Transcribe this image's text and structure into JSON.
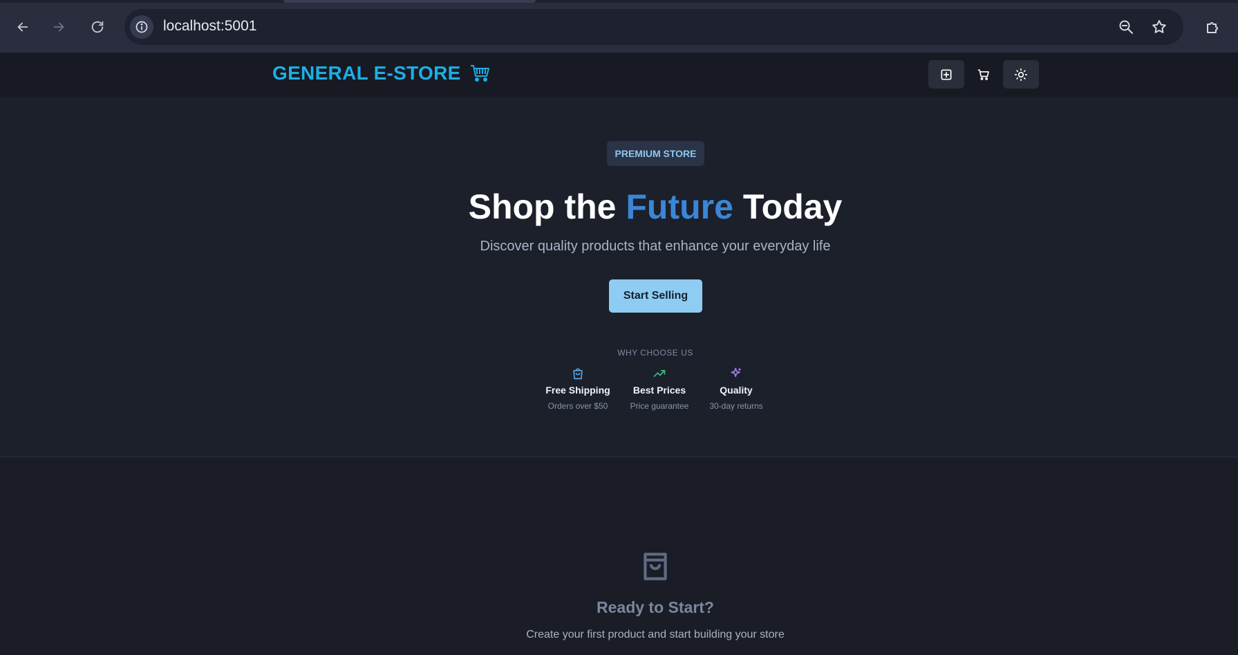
{
  "browser": {
    "url": "localhost:5001"
  },
  "header": {
    "logo_text": "GENERAL E-STORE"
  },
  "hero": {
    "badge": "PREMIUM STORE",
    "title_before": "Shop the ",
    "title_accent": "Future",
    "title_after": " Today",
    "subtitle": "Discover quality products that enhance your everyday life",
    "cta_label": "Start Selling",
    "why_label": "WHY CHOOSE US",
    "features": [
      {
        "title": "Free Shipping",
        "subtitle": "Orders over $50",
        "icon": "shopping-bag-icon",
        "color": "#5aa6e6"
      },
      {
        "title": "Best Prices",
        "subtitle": "Price guarantee",
        "icon": "trending-up-icon",
        "color": "#3fbf7f"
      },
      {
        "title": "Quality",
        "subtitle": "30-day returns",
        "icon": "sparkles-icon",
        "color": "#a479f2"
      }
    ]
  },
  "empty_state": {
    "title": "Ready to Start?",
    "subtitle": "Create your first product and start building your store"
  },
  "colors": {
    "brand": "#1eaee6",
    "accent": "#3b86d6",
    "cta": "#8fccf3",
    "background": "#1a1d26"
  }
}
